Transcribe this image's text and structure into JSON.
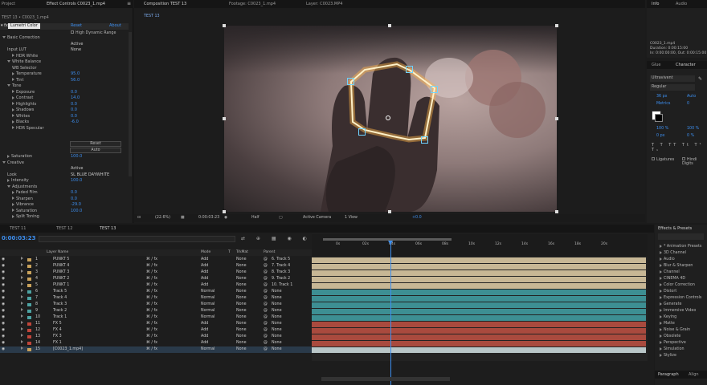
{
  "app": {
    "accent": "#2d8ceb"
  },
  "effect_controls": {
    "tab_project": "Project",
    "tab_title": "Effect Controls C0023_1.mp4",
    "header": "TEST 13 • C0023_1.mp4",
    "effect_name": "Lumetri Color",
    "reset": "Reset",
    "about": "About",
    "hdr": "High Dynamic Range",
    "rows": [
      {
        "label": "Basic Correction",
        "value": "",
        "indent": 0,
        "open": true
      },
      {
        "label": "",
        "value": "Active",
        "indent": 3,
        "open": null
      },
      {
        "label": "Input LUT",
        "value": "None",
        "indent": 1,
        "open": null
      },
      {
        "label": "HDR White",
        "value": "",
        "indent": 2,
        "open": false
      },
      {
        "label": "White Balance",
        "value": "",
        "indent": 1,
        "open": true
      },
      {
        "label": "WB Selector",
        "value": "",
        "indent": 2,
        "open": null
      },
      {
        "label": "Temperature",
        "value": "95.0",
        "indent": 2,
        "open": false
      },
      {
        "label": "Tint",
        "value": "56.0",
        "indent": 2,
        "open": false
      },
      {
        "label": "Tone",
        "value": "",
        "indent": 1,
        "open": true
      },
      {
        "label": "Exposure",
        "value": "0.0",
        "indent": 2,
        "open": false
      },
      {
        "label": "Contrast",
        "value": "14.0",
        "indent": 2,
        "open": false
      },
      {
        "label": "Highlights",
        "value": "0.0",
        "indent": 2,
        "open": false
      },
      {
        "label": "Shadows",
        "value": "0.0",
        "indent": 2,
        "open": false
      },
      {
        "label": "Whites",
        "value": "0.0",
        "indent": 2,
        "open": false
      },
      {
        "label": "Blacks",
        "value": "-6.0",
        "indent": 2,
        "open": false
      },
      {
        "label": "HDR Specular",
        "value": "",
        "indent": 2,
        "open": false
      }
    ],
    "btn_reset": "Reset",
    "btn_auto": "Auto",
    "rows2": [
      {
        "label": "Saturation",
        "value": "100.0",
        "indent": 1,
        "open": false
      },
      {
        "label": "Creative",
        "value": "",
        "indent": 0,
        "open": true
      },
      {
        "label": "",
        "value": "Active",
        "indent": 3,
        "open": null
      },
      {
        "label": "Look",
        "value": "SL BLUE DAYWHITE",
        "indent": 1,
        "open": null
      },
      {
        "label": "Intensity",
        "value": "100.0",
        "indent": 1,
        "open": false
      },
      {
        "label": "Adjustments",
        "value": "",
        "indent": 1,
        "open": true
      },
      {
        "label": "Faded Film",
        "value": "0.0",
        "indent": 2,
        "open": false
      },
      {
        "label": "Sharpen",
        "value": "0.0",
        "indent": 2,
        "open": false
      },
      {
        "label": "Vibrance",
        "value": "-29.0",
        "indent": 2,
        "open": false
      },
      {
        "label": "Saturation",
        "value": "100.0",
        "indent": 2,
        "open": false
      },
      {
        "label": "Split Toning",
        "value": "",
        "indent": 2,
        "open": false
      }
    ]
  },
  "composition": {
    "tab_comp": "Composition TEST 13",
    "tab_footage": "Footage: C0023_1.mp4",
    "tab_layer": "Layer: C0023.MP4",
    "subtab": "TEST 13",
    "zoom": "(22.6%)",
    "timecode": "0:00:03:23",
    "resolution": "Half",
    "camera": "Active Camera",
    "views": "1 View",
    "exposure": "+0.0"
  },
  "info_panel": {
    "tab_info": "Info",
    "tab_audio": "Audio",
    "lines": [
      "C0023_1.mp4",
      "Duration: 0:00:15:00",
      "In: 0:00:00:00, Out: 0:00:15:00"
    ]
  },
  "character": {
    "tab_glue": "Glue",
    "tab_character": "Character",
    "font": "Ultravivent",
    "style": "Regular",
    "size": "36 px",
    "leading": "Auto",
    "kerning": "Metrics",
    "tracking": "0",
    "vscale": "100 %",
    "hscale": "100 %",
    "baseline": "0 px",
    "tsume": "0 %",
    "ligatures": "Ligatures",
    "hindi": "Hindi Digits"
  },
  "effects_presets": {
    "title": "Effects & Presets",
    "items": [
      "* Animation Presets",
      "3D Channel",
      "Audio",
      "Blur & Sharpen",
      "Channel",
      "CINEMA 4D",
      "Color Correction",
      "Distort",
      "Expression Controls",
      "Generate",
      "Immersive Video",
      "Keying",
      "Matte",
      "Noise & Grain",
      "Obsolete",
      "Perspective",
      "Simulation",
      "Stylize"
    ],
    "tab_paragraph": "Paragraph",
    "tab_align": "Align"
  },
  "timeline": {
    "tabs": [
      "TEST 11",
      "TEST 12",
      "TEST 13"
    ],
    "timecode": "0:00:03:23",
    "col_layer": "Layer Name",
    "col_mode": "Mode",
    "col_t": "T",
    "col_trkmat": "TrkMat",
    "col_parent": "Parent",
    "ruler": [
      "0s",
      "02s",
      "04s",
      "06s",
      "08s",
      "10s",
      "12s",
      "14s",
      "16s",
      "18s",
      "20s"
    ],
    "layers": [
      {
        "num": "1",
        "name": "PUNKT 5",
        "mode": "Add",
        "trk": "None",
        "parent": "6. Track 5",
        "color": "#c9a25b",
        "bar": "#c7b795"
      },
      {
        "num": "2",
        "name": "PUNKT 4",
        "mode": "Add",
        "trk": "None",
        "parent": "7. Track 4",
        "color": "#c9a25b",
        "bar": "#c7b795"
      },
      {
        "num": "3",
        "name": "PUNKT 3",
        "mode": "Add",
        "trk": "None",
        "parent": "8. Track 3",
        "color": "#c9a25b",
        "bar": "#c7b795"
      },
      {
        "num": "4",
        "name": "PUNKT 2",
        "mode": "Add",
        "trk": "None",
        "parent": "9. Track 2",
        "color": "#c9a25b",
        "bar": "#c7b795"
      },
      {
        "num": "5",
        "name": "PUNKT 1",
        "mode": "Add",
        "trk": "None",
        "parent": "10. Track 1",
        "color": "#c9a25b",
        "bar": "#c7b795"
      },
      {
        "num": "6",
        "name": "Track 5",
        "mode": "Normal",
        "trk": "None",
        "parent": "None",
        "color": "#4da3a3",
        "bar": "#3d8f93"
      },
      {
        "num": "7",
        "name": "Track 4",
        "mode": "Normal",
        "trk": "None",
        "parent": "None",
        "color": "#4da3a3",
        "bar": "#3d8f93"
      },
      {
        "num": "8",
        "name": "Track 3",
        "mode": "Normal",
        "trk": "None",
        "parent": "None",
        "color": "#4da3a3",
        "bar": "#3d8f93"
      },
      {
        "num": "9",
        "name": "Track 2",
        "mode": "Normal",
        "trk": "None",
        "parent": "None",
        "color": "#4da3a3",
        "bar": "#3d8f93"
      },
      {
        "num": "10",
        "name": "Track 1",
        "mode": "Normal",
        "trk": "None",
        "parent": "None",
        "color": "#4da3a3",
        "bar": "#3d8f93"
      },
      {
        "num": "11",
        "name": "FX 5",
        "mode": "Add",
        "trk": "None",
        "parent": "None",
        "color": "#c0453a",
        "bar": "#a94a3e"
      },
      {
        "num": "12",
        "name": "FX 4",
        "mode": "Add",
        "trk": "None",
        "parent": "None",
        "color": "#c0453a",
        "bar": "#a94a3e"
      },
      {
        "num": "13",
        "name": "FX 3",
        "mode": "Add",
        "trk": "None",
        "parent": "None",
        "color": "#c0453a",
        "bar": "#a94a3e"
      },
      {
        "num": "14",
        "name": "FX 1",
        "mode": "Add",
        "trk": "None",
        "parent": "None",
        "color": "#c0453a",
        "bar": "#a94a3e"
      },
      {
        "num": "15",
        "name": "[C0023_1.mp4]",
        "mode": "Normal",
        "trk": "None",
        "parent": "None",
        "color": "#c9a25b",
        "bar": "#b9c6c8"
      }
    ]
  }
}
